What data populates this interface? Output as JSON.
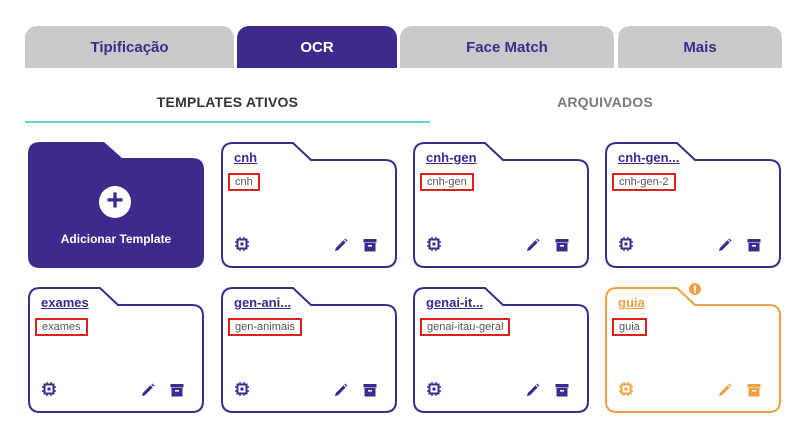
{
  "top_tabs": [
    {
      "label": "Tipificação",
      "active": false
    },
    {
      "label": "OCR",
      "active": true
    },
    {
      "label": "Face Match",
      "active": false
    },
    {
      "label": "Mais",
      "active": false
    }
  ],
  "sub_tabs": [
    {
      "label": "TEMPLATES ATIVOS",
      "active": true
    },
    {
      "label": "ARQUIVADOS",
      "active": false
    }
  ],
  "add_template": {
    "label": "Adicionar Template",
    "icon": "plus-icon"
  },
  "templates": [
    {
      "name": "cnh",
      "sub": "cnh",
      "warning": false
    },
    {
      "name": "cnh-gen",
      "sub": "cnh-gen",
      "warning": false
    },
    {
      "name": "cnh-gen...",
      "sub": "cnh-gen-2",
      "warning": false
    },
    {
      "name": "exames",
      "sub": "exames",
      "warning": false
    },
    {
      "name": "gen-ani...",
      "sub": "gen-animais",
      "warning": false
    },
    {
      "name": "genai-it...",
      "sub": "genai-itau-geral",
      "warning": false
    },
    {
      "name": "guia",
      "sub": "guia",
      "warning": true
    }
  ],
  "colors": {
    "primary": "#3e2a8c",
    "tab_inactive": "#c9c9c9",
    "underline": "#5fd3e0",
    "highlight_box": "#e0201a",
    "warning": "#f0a040"
  },
  "icons": [
    "chip-icon",
    "edit-pencil-icon",
    "archive-icon",
    "warning-icon"
  ]
}
